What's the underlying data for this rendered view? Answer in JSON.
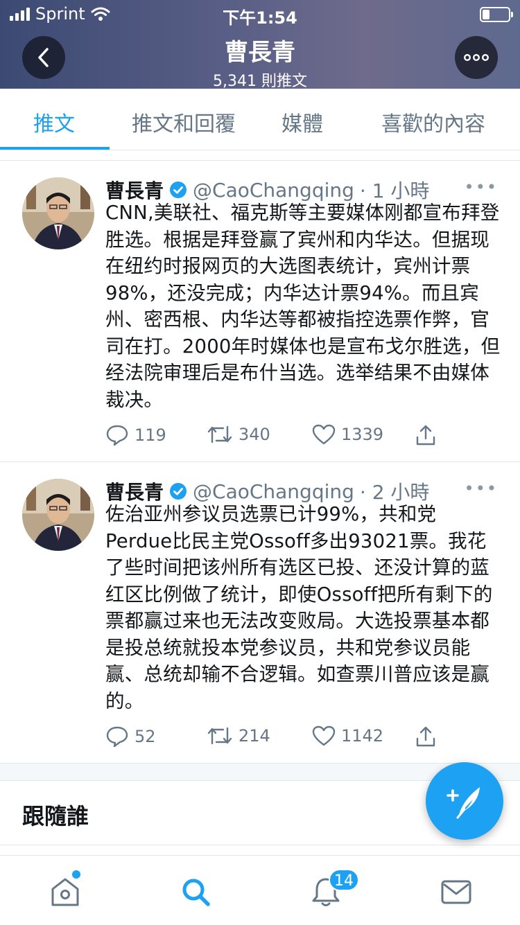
{
  "status": {
    "carrier": "Sprint",
    "time": "下午1:54"
  },
  "header": {
    "name": "曹長青",
    "tweet_count": "5,341 則推文"
  },
  "tabs": [
    "推文",
    "推文和回覆",
    "媒體",
    "喜歡的內容"
  ],
  "tweets": [
    {
      "name": "曹長青",
      "handle": "@CaoChangqing",
      "time": "· 1 小時",
      "text": "CNN,美联社、福克斯等主要媒体刚都宣布拜登胜选。根据是拜登赢了宾州和内华达。但据现在纽约时报网页的大选图表统计，宾州计票98%，还没完成；内华达计票94%。而且宾州、密西根、内华达等都被指控选票作弊，官司在打。2000年时媒体也是宣布戈尔胜选，但经法院审理后是布什当选。选举结果不由媒体裁决。",
      "replies": "119",
      "retweets": "340",
      "likes": "1339"
    },
    {
      "name": "曹長青",
      "handle": "@CaoChangqing",
      "time": "· 2 小時",
      "text": "佐治亚州参议员选票已计99%，共和党Perdue比民主党Ossoff多出93021票。我花了些时间把该州所有选区已投、还没计算的蓝红区比例做了统计，即使Ossoff把所有剩下的票都赢过来也无法改变败局。大选投票基本都是投总统就投本党参议员，共和党参议员能赢、总统却输不合逻辑。如查票川普应该是赢的。",
      "replies": "52",
      "retweets": "214",
      "likes": "1142"
    }
  ],
  "follow_section": {
    "title": "跟隨誰"
  },
  "tabbar": {
    "notifications_badge": "14"
  },
  "colors": {
    "accent": "#1da1f2",
    "muted": "#657786"
  }
}
